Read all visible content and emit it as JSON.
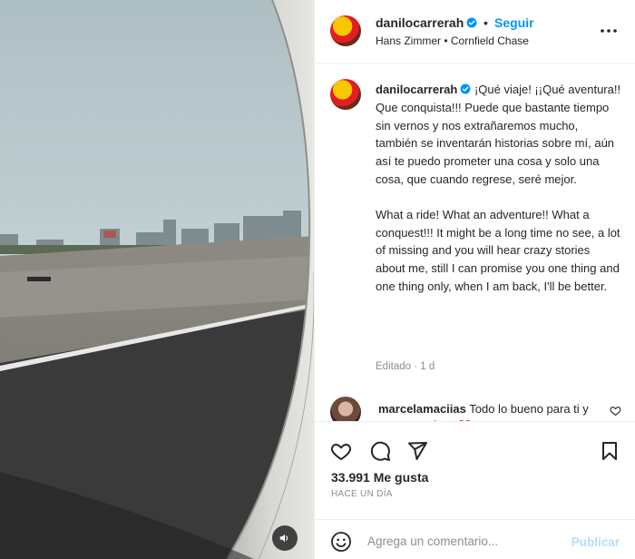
{
  "post": {
    "username": "danilocarrerah",
    "separator": "•",
    "follow_label": "Seguir",
    "song": "Hans Zimmer • Cornfield Chase",
    "caption_user": "danilocarrerah",
    "caption_es": "¡Qué viaje! ¡¡Qué aventura!! Que conquista!!! Puede que bastante tiempo sin vernos y nos extrañaremos mucho, también se inventarán historias sobre mí, aún así te puedo prometer una cosa y solo una cosa, que cuando regrese, seré mejor.",
    "caption_en": "What a ride! What an adventure!! What a conquest!!! It might be a long time no see, a lot of missing and you will hear crazy stories about me, still I can promise you one thing and one thing only, when I am back, I'll be better.",
    "meta": "Editado · 1 d",
    "likes": "33.991 Me gusta",
    "time": "HACE UN DÍA"
  },
  "comment": {
    "username": "marcelamaciias",
    "text": "Todo lo bueno para ti y los tuyos 🙏🏻🙌🏼❤️"
  },
  "composer": {
    "placeholder": "Agrega un comentario...",
    "publish_label": "Publicar"
  },
  "icons": {
    "verified": "verified-badge-icon",
    "more": "more-options-icon",
    "like": "heart-icon",
    "comment": "comment-bubble-icon",
    "share": "paper-plane-icon",
    "save": "bookmark-icon",
    "emoji": "smiley-icon",
    "mute": "speaker-icon"
  },
  "colors": {
    "accent": "#0095f6",
    "publish_disabled": "#b2dffc",
    "muted_text": "#8e8e8e",
    "heart_red": "#ed1c24"
  }
}
